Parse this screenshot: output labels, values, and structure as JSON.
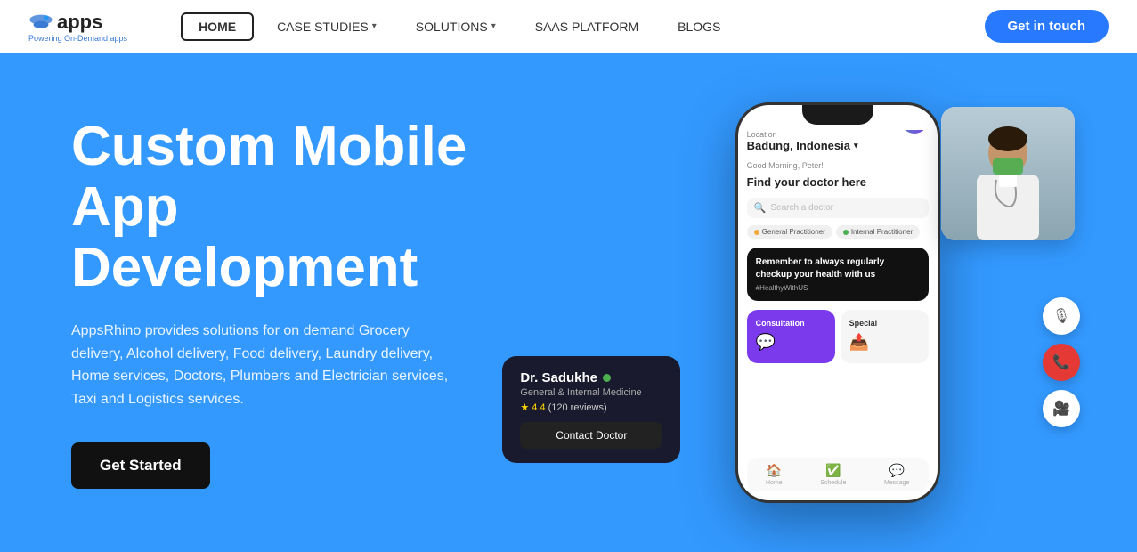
{
  "navbar": {
    "logo_text": "apps",
    "logo_sub": "Powering On-Demand apps",
    "nav_home": "HOME",
    "nav_case_studies": "CASE STUDIES",
    "nav_solutions": "SOLUTIONS",
    "nav_saas": "SAAS PLATFORM",
    "nav_blogs": "BLOGS",
    "cta_label": "Get in touch"
  },
  "hero": {
    "title_line1": "Custom Mobile",
    "title_line2": "App",
    "title_line3": "Development",
    "description": "AppsRhino provides solutions for on demand Grocery delivery, Alcohol delivery, Food delivery, Laundry delivery, Home services, Doctors, Plumbers and Electrician services, Taxi and Logistics services.",
    "btn_label": "Get Started"
  },
  "phone_ui": {
    "location_label": "Location",
    "city": "Badung, Indonesia",
    "greeting": "Good Morning, Peter!",
    "find_text": "Find your doctor here",
    "search_placeholder": "Search a doctor",
    "tag1": "General Practitioner",
    "tag2": "Internal Practitioner",
    "reminder_title": "Remember to always regularly checkup your health with us",
    "reminder_tag": "#HealthyWithUS",
    "service1_label": "Consultation",
    "service2_label": "Special",
    "nav1": "Home",
    "nav2": "Schedule",
    "nav3": "Message"
  },
  "doctor_card": {
    "name": "Dr. Sadukhe",
    "specialty": "General & Internal Medicine",
    "rating": "★ 4.4",
    "reviews": "(120 reviews)",
    "contact_btn": "Contact Doctor"
  },
  "call_btns": {
    "mute_icon": "🎤",
    "call_icon": "📞",
    "video_icon": "🎥"
  }
}
